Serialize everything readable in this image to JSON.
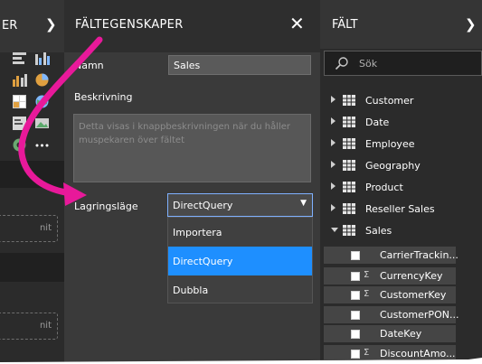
{
  "viz_pane": {
    "title": "ER",
    "expand_icon": "chevron-right-icon",
    "well_labels": [
      "nit",
      "nit"
    ]
  },
  "properties_pane": {
    "title": "FÄLTEGENSKAPER",
    "close_icon": "close-icon",
    "name_label": "Namn",
    "name_value": "Sales",
    "description_label": "Beskrivning",
    "description_placeholder": "Detta visas i knappbeskrivningen när du håller muspekaren över fältet",
    "storage_label": "Lagringsläge",
    "storage_value": "DirectQuery",
    "storage_options": [
      "Importera",
      "DirectQuery",
      "Dubbla"
    ],
    "selected_option": "DirectQuery"
  },
  "fields_pane": {
    "title": "FÄLT",
    "expand_icon": "chevron-right-icon",
    "search_placeholder": "Sök",
    "tables": [
      "Customer",
      "Date",
      "Employee",
      "Geography",
      "Product",
      "Reseller Sales",
      "Sales"
    ],
    "expanded_table": "Sales",
    "sales_fields": [
      {
        "name": "CarrierTrackin...",
        "sigma": ""
      },
      {
        "name": "CurrencyKey",
        "sigma": "Σ"
      },
      {
        "name": "CustomerKey",
        "sigma": "Σ"
      },
      {
        "name": "CustomerPON...",
        "sigma": ""
      },
      {
        "name": "DateKey",
        "sigma": ""
      },
      {
        "name": "DiscountAmo...",
        "sigma": "Σ"
      }
    ]
  },
  "colors": {
    "annotation_arrow": "#e8199a",
    "selected_option_bg": "#1e8fff",
    "focus_border": "#7fb1ff"
  }
}
